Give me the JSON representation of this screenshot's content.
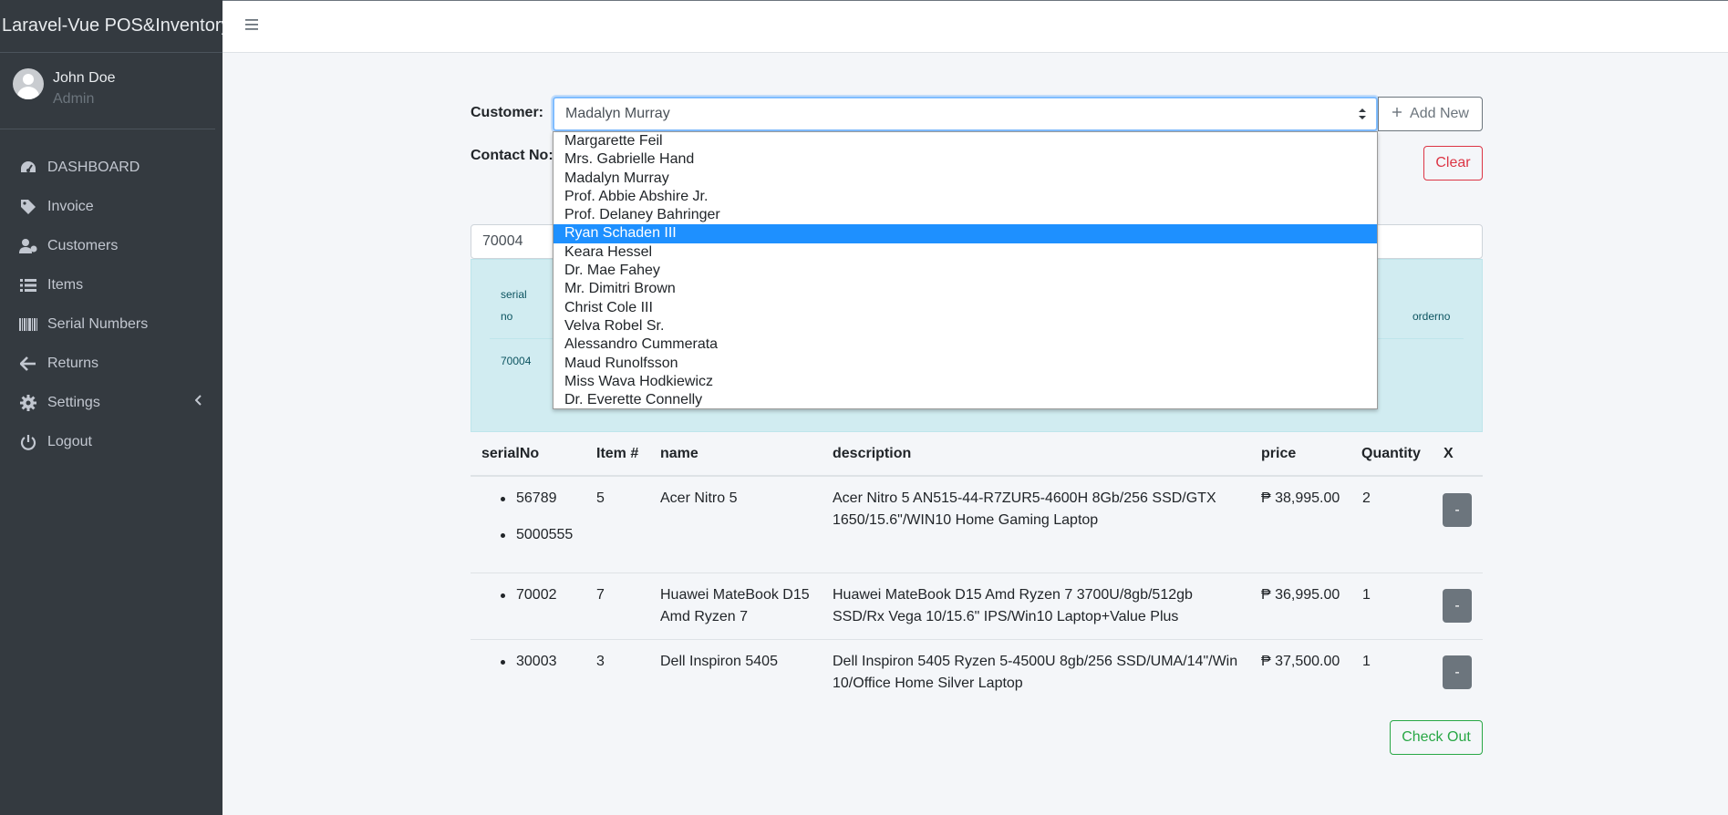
{
  "app": {
    "brand": "Laravel-Vue POS&Inventory"
  },
  "user": {
    "name": "John Doe",
    "role": "Admin"
  },
  "sidebar": {
    "items": [
      {
        "label": "DASHBOARD",
        "icon": "speedometer-icon"
      },
      {
        "label": "Invoice",
        "icon": "tag-icon"
      },
      {
        "label": "Customers",
        "icon": "users-icon"
      },
      {
        "label": "Items",
        "icon": "list-icon"
      },
      {
        "label": "Serial Numbers",
        "icon": "barcode-icon"
      },
      {
        "label": "Returns",
        "icon": "arrow-left-icon"
      },
      {
        "label": "Settings",
        "icon": "gear-icon"
      },
      {
        "label": "Logout",
        "icon": "power-icon"
      }
    ]
  },
  "form": {
    "customer_label": "Customer:",
    "customer_selected": "Madalyn Murray",
    "add_new_label": "Add New",
    "contact_label": "Contact No:",
    "clear_label": "Clear",
    "serial_input_value": "70004"
  },
  "result": {
    "col_serial_line1": "serial",
    "col_serial_line2": "no",
    "col_orderno": "orderno",
    "row_serial": "70004"
  },
  "dropdown": {
    "options": [
      "Margarette Feil",
      "Mrs. Gabrielle Hand",
      "Madalyn Murray",
      "Prof. Abbie Abshire Jr.",
      "Prof. Delaney Bahringer",
      "Ryan Schaden III",
      "Keara Hessel",
      "Dr. Mae Fahey",
      "Mr. Dimitri Brown",
      "Christ Cole III",
      "Velva Robel Sr.",
      "Alessandro Cummerata",
      "Maud Runolfsson",
      "Miss Wava Hodkiewicz",
      "Dr. Everette Connelly"
    ],
    "highlighted": "Ryan Schaden III"
  },
  "table": {
    "headers": {
      "serial": "serialNo",
      "item": "Item #",
      "name": "name",
      "description": "description",
      "price": "price",
      "quantity": "Quantity",
      "x": "X"
    },
    "rows": [
      {
        "serials": [
          "56789",
          "5000555"
        ],
        "item": "5",
        "name": "Acer Nitro 5",
        "desc1": "Acer Nitro 5 AN515-44-R7ZUR5-4600H 8Gb/256 SSD/GTX",
        "desc2": "1650/15.6\"/WIN10 Home Gaming Laptop",
        "price": "₱ 38,995.00",
        "quantity": "2",
        "remove": "-"
      },
      {
        "serials": [
          "70002"
        ],
        "item": "7",
        "name1": "Huawei MateBook D15",
        "name2": "Amd Ryzen 7",
        "desc1": "Huawei MateBook D15 Amd Ryzen 7 3700U/8gb/512gb",
        "desc2": "SSD/Rx Vega 10/15.6\" IPS/Win10 Laptop+Value Plus",
        "price": "₱ 36,995.00",
        "quantity": "1",
        "remove": "-"
      },
      {
        "serials": [
          "30003"
        ],
        "item": "3",
        "name": "Dell Inspiron 5405",
        "desc1": "Dell Inspiron 5405 Ryzen 5-4500U 8gb/256 SSD/UMA/14\"/Win",
        "desc2": "10/Office Home Silver Laptop",
        "price": "₱ 37,500.00",
        "quantity": "1",
        "remove": "-"
      }
    ]
  },
  "checkout_label": "Check Out"
}
